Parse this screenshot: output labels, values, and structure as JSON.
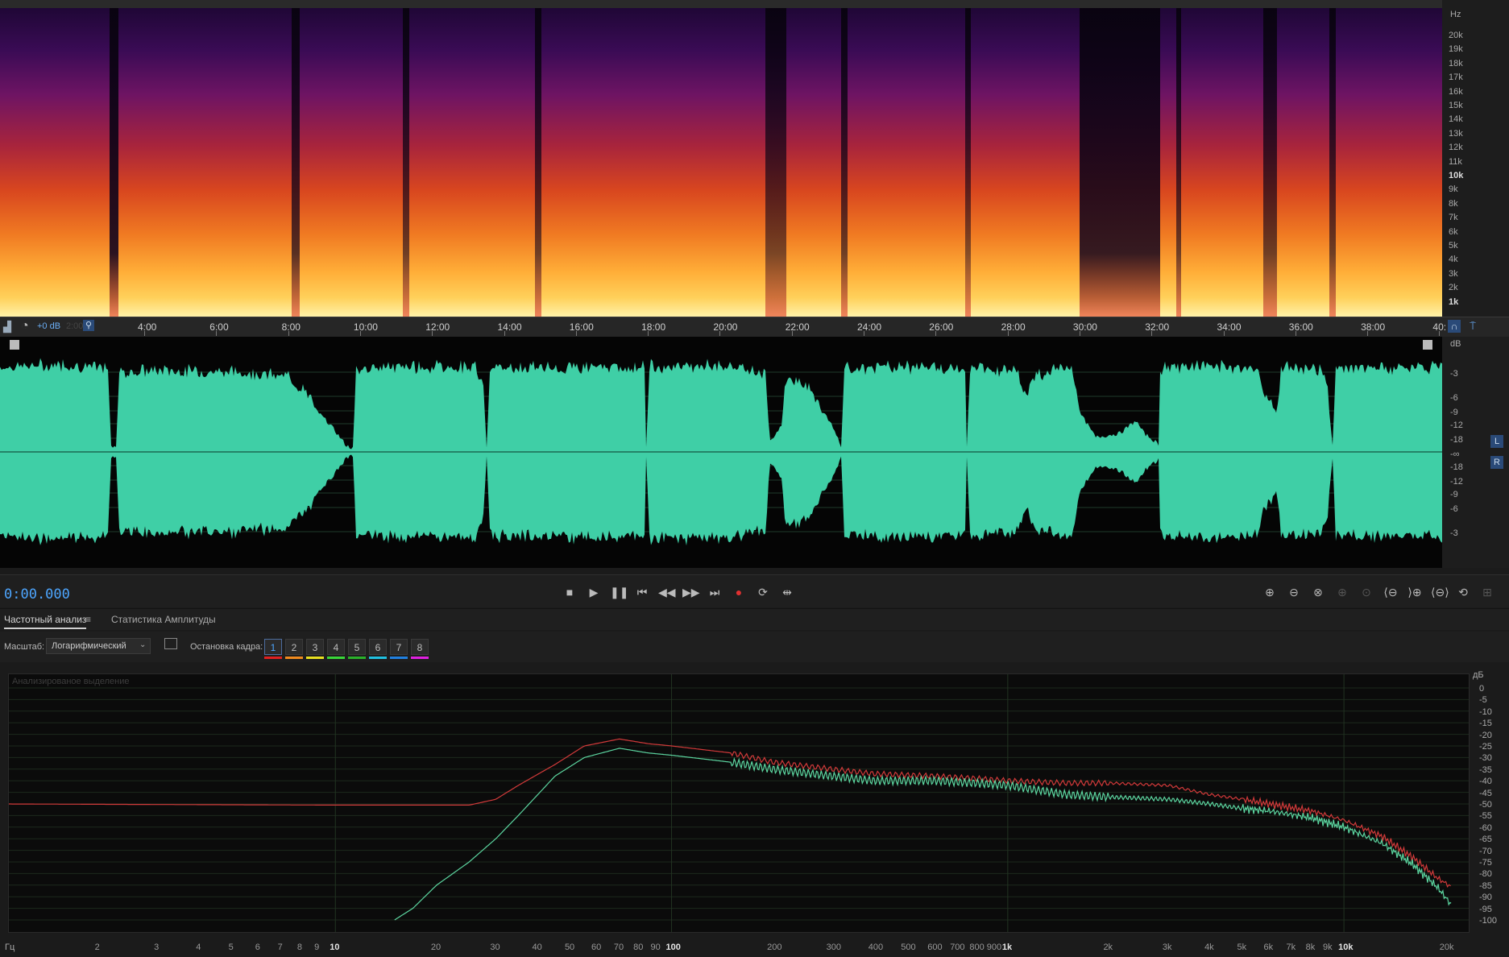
{
  "spectrogram": {
    "unit_label": "Hz",
    "freq_labels": [
      "20k",
      "19k",
      "18k",
      "17k",
      "16k",
      "15k",
      "14k",
      "13k",
      "12k",
      "11k",
      "10k",
      "9k",
      "8k",
      "7k",
      "6k",
      "5k",
      "4k",
      "3k",
      "2k",
      "1k"
    ]
  },
  "timeline": {
    "gain_label": "+0 dB",
    "hidden_time": "2:00",
    "time_labels": [
      "4:00",
      "6:00",
      "8:00",
      "10:00",
      "12:00",
      "14:00",
      "16:00",
      "18:00",
      "20:00",
      "22:00",
      "24:00",
      "26:00",
      "28:00",
      "30:00",
      "32:00",
      "34:00",
      "36:00",
      "38:00",
      "40:"
    ]
  },
  "waveform": {
    "unit_label": "dB",
    "db_labels": [
      "-3",
      "-6",
      "-9",
      "-12",
      "-18",
      "-∞",
      "-18",
      "-12",
      "-9",
      "-6",
      "-3"
    ],
    "channel_left": "L",
    "channel_right": "R",
    "color": "#3fcfa6"
  },
  "transport": {
    "time": "0:00.000",
    "buttons": [
      "stop",
      "play",
      "pause",
      "go-to-start",
      "rewind",
      "fast-forward",
      "go-to-end",
      "record",
      "loop",
      "skip"
    ]
  },
  "panel": {
    "tabs": [
      "Частотный анализ",
      "Статистика Амплитуды"
    ],
    "menu_icon": "≡",
    "scale_label": "Масштаб:",
    "scale_value": "Логарифмический",
    "freeze_label": "Остановка кадра:",
    "freeze_buttons": [
      "1",
      "2",
      "3",
      "4",
      "5",
      "6",
      "7",
      "8"
    ],
    "freeze_colors": [
      "#e02020",
      "#f08a1e",
      "#e8e020",
      "#39d639",
      "#2ab22a",
      "#20c0e0",
      "#2080e0",
      "#e020e0"
    ],
    "graph_caption": "Анализированое выделение"
  },
  "analysis": {
    "db_unit": "дБ",
    "db_labels": [
      "0",
      "-5",
      "-10",
      "-15",
      "-20",
      "-25",
      "-30",
      "-35",
      "-40",
      "-45",
      "-50",
      "-55",
      "-60",
      "-65",
      "-70",
      "-75",
      "-80",
      "-85",
      "-90",
      "-95",
      "-100"
    ],
    "hz_unit": "Гц",
    "freq_labels": [
      "2",
      "3",
      "4",
      "5",
      "6",
      "7",
      "8",
      "9",
      "10",
      "20",
      "30",
      "40",
      "50",
      "60",
      "70",
      "80",
      "90",
      "100",
      "200",
      "300",
      "400",
      "500",
      "600",
      "700",
      "800",
      "900",
      "1k",
      "2k",
      "3k",
      "4k",
      "5k",
      "6k",
      "7k",
      "8k",
      "9k",
      "10k",
      "20k"
    ],
    "series": [
      {
        "color": "#d23a3a"
      },
      {
        "color": "#5cd6a0"
      }
    ]
  }
}
